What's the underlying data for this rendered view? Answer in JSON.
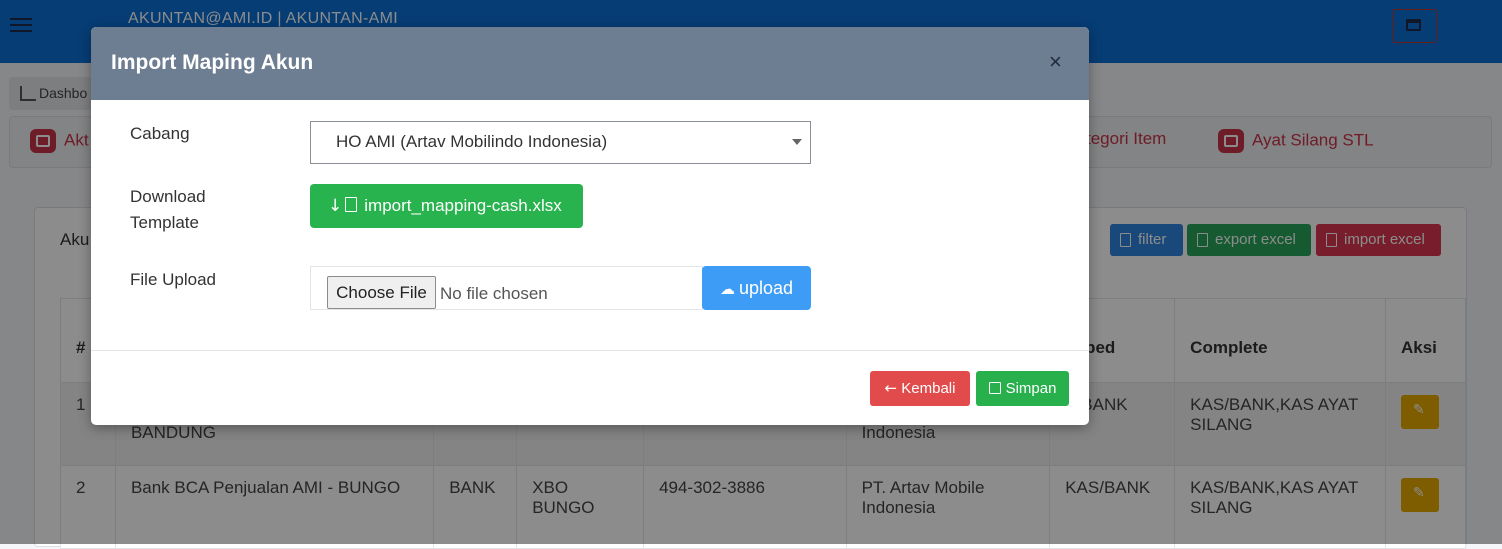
{
  "app": {
    "user_title": "AKUNTAN@AMI.ID | AKUNTAN-AMI",
    "breadcrumb": "Dashbo"
  },
  "tabs": [
    {
      "label": "Akt"
    },
    {
      "label": "tegori Item"
    },
    {
      "label": "Ayat Silang STL"
    }
  ],
  "card": {
    "title": "Aku",
    "filter_label": "filter",
    "export_label": "export excel",
    "import_label": "import excel"
  },
  "table": {
    "headers": [
      "#",
      "apped",
      "Complete",
      "Aksi"
    ],
    "rows": [
      {
        "no": "1",
        "name": "BANDUNG",
        "company": "Indonesia",
        "mapped": "S/BANK",
        "complete": "KAS/BANK,KAS AYAT SILANG"
      },
      {
        "no": "2",
        "name": "Bank BCA Penjualan AMI - BUNGO",
        "type": "BANK",
        "code": "XBO BUNGO",
        "account": "494-302-3886",
        "company": "PT. Artav Mobile Indonesia",
        "mapped": "KAS/BANK",
        "complete": "KAS/BANK,KAS AYAT SILANG"
      }
    ]
  },
  "modal": {
    "title": "Import Maping Akun",
    "close_glyph": "×",
    "cabang_label": "Cabang",
    "cabang_value": "HO AMI (Artav Mobilindo Indonesia)",
    "download_label_1": "Download",
    "download_label_2": "Template",
    "download_file": "import_mapping-cash.xlsx",
    "upload_label": "File Upload",
    "choose_file": "Choose File",
    "no_file": "No file chosen",
    "upload_button": "upload",
    "kembali_button": "Kembali",
    "simpan_button": "Simpan"
  },
  "colors": {
    "topbar": "#0b6fd6",
    "modal_header": "#6d7d92",
    "success": "#28b34e",
    "danger": "#e24b4b",
    "primary": "#3d9cf5"
  }
}
